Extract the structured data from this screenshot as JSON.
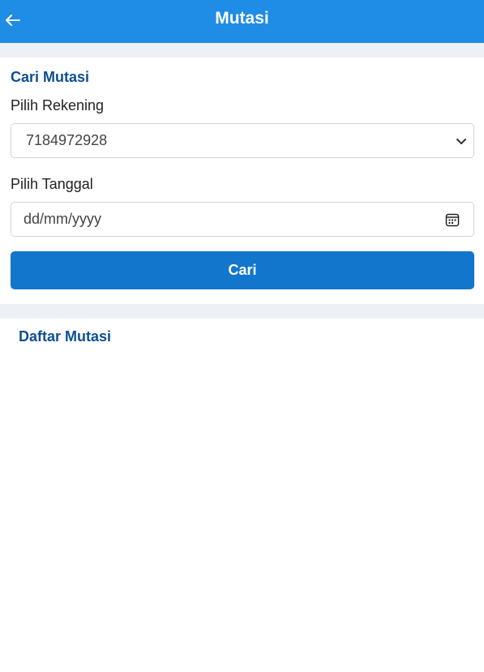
{
  "header": {
    "title": "Mutasi",
    "back_icon": "arrow-left-icon",
    "background_color": "#1f8ce6"
  },
  "search": {
    "title": "Cari Mutasi",
    "account_label": "Pilih Rekening",
    "account_value": "7184972928",
    "account_icon": "chevron-down-icon",
    "date_label": "Pilih Tanggal",
    "date_placeholder": "dd/mm/yyyy",
    "date_icon": "calendar-icon",
    "button_label": "Cari",
    "button_color": "#1276cc"
  },
  "list": {
    "title": "Daftar Mutasi"
  }
}
